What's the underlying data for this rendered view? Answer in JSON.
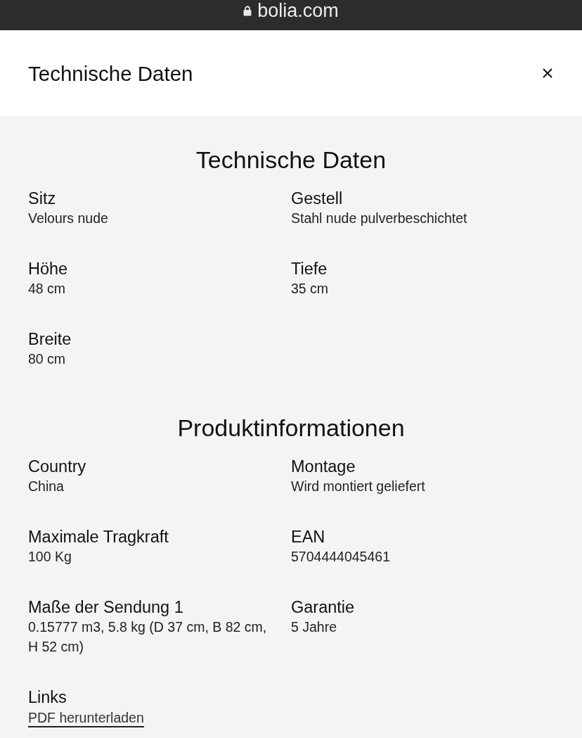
{
  "browser_bar": {
    "url": "bolia.com"
  },
  "header": {
    "title": "Technische Daten"
  },
  "sections": [
    {
      "heading": "Technische Daten",
      "items": [
        {
          "kind": "text",
          "label": "Sitz",
          "value": "Velours nude"
        },
        {
          "kind": "text",
          "label": "Gestell",
          "value": "Stahl nude pulverbeschichtet"
        },
        {
          "kind": "text",
          "label": "Höhe",
          "value": "48 cm"
        },
        {
          "kind": "text",
          "label": "Tiefe",
          "value": "35 cm"
        },
        {
          "kind": "text",
          "label": "Breite",
          "value": "80 cm"
        }
      ]
    },
    {
      "heading": "Produktinformationen",
      "items": [
        {
          "kind": "text",
          "label": "Country",
          "value": "China"
        },
        {
          "kind": "text",
          "label": "Montage",
          "value": "Wird montiert geliefert"
        },
        {
          "kind": "text",
          "label": "Maximale Tragkraft",
          "value": "100 Kg"
        },
        {
          "kind": "text",
          "label": "EAN",
          "value": "5704444045461"
        },
        {
          "kind": "text",
          "label": "Maße der Sendung 1",
          "value": "0.15777 m3, 5.8 kg (D 37 cm, B 82 cm, H 52 cm)"
        },
        {
          "kind": "text",
          "label": "Garantie",
          "value": "5 Jahre"
        },
        {
          "kind": "link",
          "label": "Links",
          "value": "PDF herunterladen"
        }
      ]
    }
  ]
}
